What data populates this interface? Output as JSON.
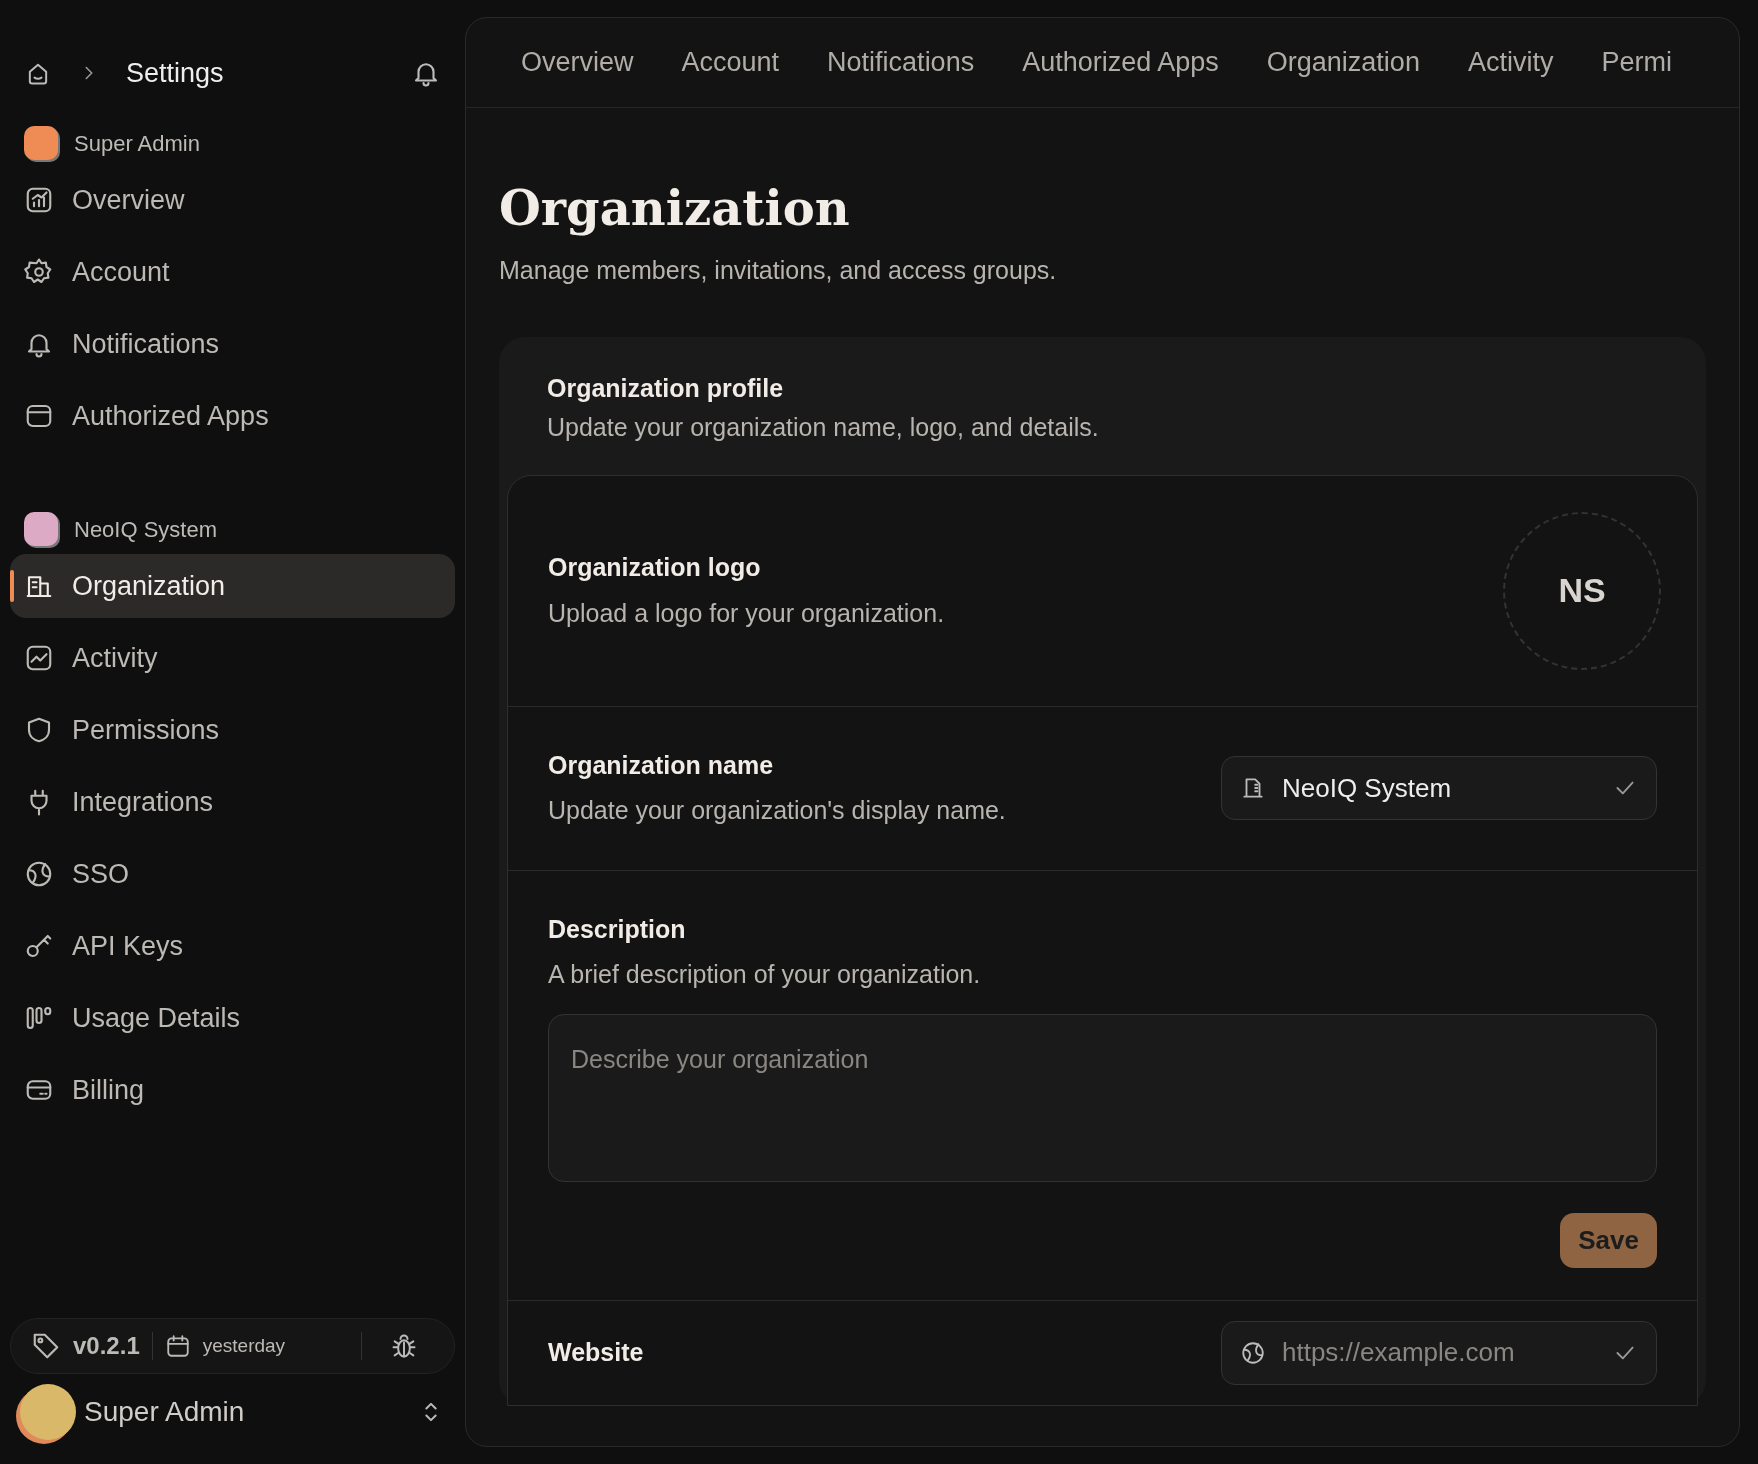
{
  "header": {
    "title": "Settings"
  },
  "sidebar": {
    "sections": [
      {
        "account": "Super Admin",
        "color": "#ef8c55",
        "items": [
          {
            "label": "Overview",
            "kind": "chart",
            "selected": false
          },
          {
            "label": "Account",
            "kind": "gear",
            "selected": false
          },
          {
            "label": "Notifications",
            "kind": "bell",
            "selected": false
          },
          {
            "label": "Authorized Apps",
            "kind": "window",
            "selected": false
          }
        ]
      },
      {
        "account": "NeoIQ System",
        "color": "#dcaac4",
        "items": [
          {
            "label": "Organization",
            "kind": "building",
            "selected": true
          },
          {
            "label": "Activity",
            "kind": "activity",
            "selected": false
          },
          {
            "label": "Permissions",
            "kind": "shield",
            "selected": false
          },
          {
            "label": "Integrations",
            "kind": "plug",
            "selected": false
          },
          {
            "label": "SSO",
            "kind": "globe",
            "selected": false
          },
          {
            "label": "API Keys",
            "kind": "key",
            "selected": false
          },
          {
            "label": "Usage Details",
            "kind": "bars",
            "selected": false
          },
          {
            "label": "Billing",
            "kind": "card",
            "selected": false
          }
        ]
      }
    ]
  },
  "footer": {
    "version": "v0.2.1",
    "date": "yesterday",
    "user": "Super Admin"
  },
  "tabs": [
    {
      "label": "Overview",
      "selected": false
    },
    {
      "label": "Account",
      "selected": false
    },
    {
      "label": "Notifications",
      "selected": false
    },
    {
      "label": "Authorized Apps",
      "selected": false
    },
    {
      "label": "Organization",
      "selected": false
    },
    {
      "label": "Activity",
      "selected": false
    },
    {
      "label": "Permi",
      "selected": false
    }
  ],
  "page": {
    "title": "Organization",
    "subtitle": "Manage members, invitations, and access groups."
  },
  "profile": {
    "title": "Organization profile",
    "subtitle": "Update your organization name, logo, and details.",
    "rows": [
      {
        "kind": "logo",
        "title": "Organization logo",
        "subtitle": "Upload a logo for your organization.",
        "initials": "NS"
      },
      {
        "kind": "name",
        "title": "Organization name",
        "subtitle": "Update your organization's display name.",
        "value": "NeoIQ System"
      },
      {
        "kind": "description",
        "title": "Description",
        "subtitle": "A brief description of your organization.",
        "placeholder": "Describe your organization",
        "button": "Save"
      },
      {
        "kind": "website",
        "title": "Website",
        "placeholder": "https://example.com"
      }
    ]
  }
}
